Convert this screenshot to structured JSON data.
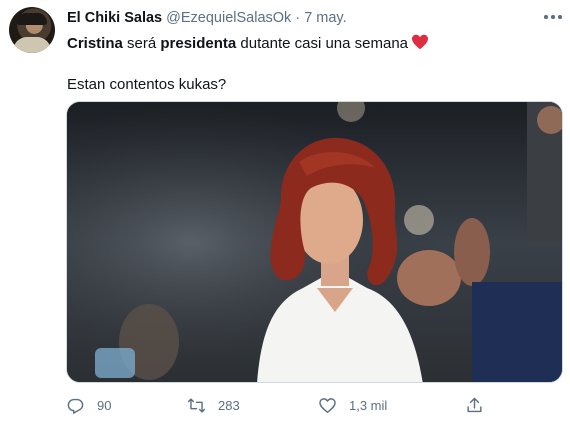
{
  "tweet": {
    "author": {
      "name": "El Chiki Salas",
      "handle": "@EzequielSalasOk",
      "separator": "·",
      "date": "7 may."
    },
    "text": {
      "bold_1": "Cristina",
      "plain_1": " será ",
      "bold_2": "presidenta",
      "plain_2": " dutante casi una semana",
      "emoji": "heart-red",
      "line_2": "Estan contentos kukas?"
    },
    "actions": {
      "replies": "90",
      "retweets": "283",
      "likes": "1,3 mil"
    },
    "icons": [
      "more-icon",
      "reply-icon",
      "retweet-icon",
      "like-icon",
      "share-icon"
    ],
    "colors": {
      "text": "#0f1419",
      "secondary": "#5b7083",
      "heart": "#e0245e"
    }
  }
}
